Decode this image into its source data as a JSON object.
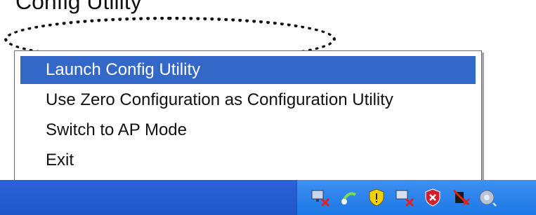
{
  "caption": {
    "text": "Config Utility"
  },
  "menu": {
    "items": [
      {
        "label": "Launch Config Utility",
        "selected": true
      },
      {
        "label": "Use Zero Configuration as Configuration Utility",
        "selected": false
      },
      {
        "label": "Switch to AP Mode",
        "selected": false
      },
      {
        "label": "Exit",
        "selected": false
      }
    ]
  },
  "tray": {
    "icons": [
      "network-disconnected-icon",
      "network-connection-icon",
      "security-shield-icon",
      "network-error-icon",
      "antivirus-shield-icon",
      "wireless-disabled-icon",
      "volume-icon"
    ]
  },
  "colors": {
    "selection": "#3468c8",
    "taskbar": "#245edb",
    "tray": "#2a84ea"
  }
}
